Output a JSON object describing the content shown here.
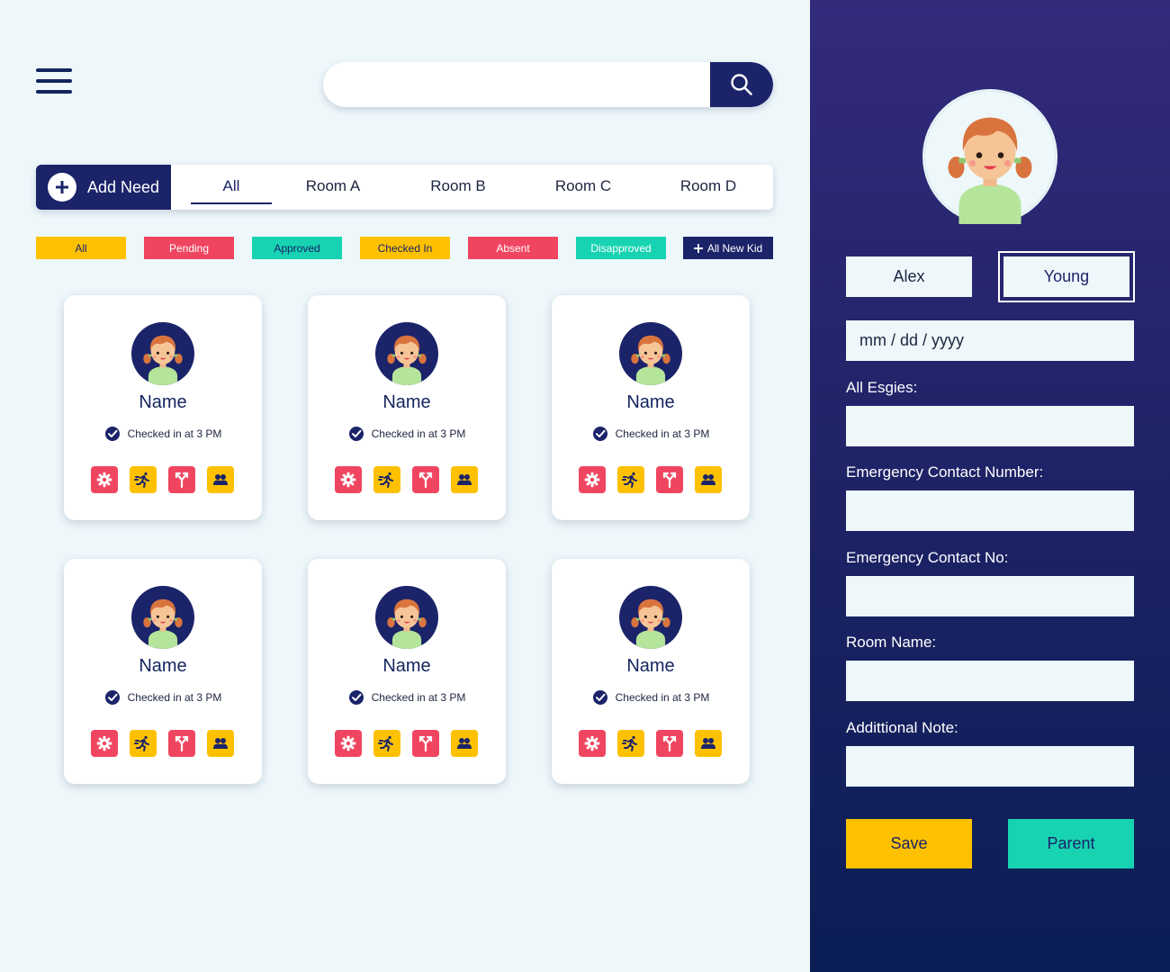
{
  "search": {
    "placeholder": ""
  },
  "tabs": {
    "add_need_label": "Add Need",
    "items": [
      "All",
      "Room A",
      "Room B",
      "Room C",
      "Room D"
    ],
    "active": "All"
  },
  "filters": [
    {
      "label": "All",
      "color": "#fdc100"
    },
    {
      "label": "Pending",
      "color": "#f04560"
    },
    {
      "label": "Approved",
      "color": "#17d3b2"
    },
    {
      "label": "Checked In",
      "color": "#fdc100"
    },
    {
      "label": "Absent",
      "color": "#f04560"
    },
    {
      "label": "Disapproved",
      "color": "#17d3b2"
    },
    {
      "label": "All New Kid",
      "color": "#1b2369"
    }
  ],
  "cards": [
    {
      "name": "Name",
      "status": "Checked in at 3 PM"
    },
    {
      "name": "Name",
      "status": "Checked in at 3 PM"
    },
    {
      "name": "Name",
      "status": "Checked in at 3 PM"
    },
    {
      "name": "Name",
      "status": "Checked in at 3 PM"
    },
    {
      "name": "Name",
      "status": "Checked in at 3 PM"
    },
    {
      "name": "Name",
      "status": "Checked in at 3 PM"
    }
  ],
  "card_icons": [
    "gear-icon",
    "running-icon",
    "fork-icon",
    "group-icon"
  ],
  "panel": {
    "first_name": "Alex",
    "last_name": "Young",
    "date_placeholder": "mm / dd / yyyy",
    "labels": {
      "allergies": "All Esgies:",
      "emergency_number": "Emergency Contact Number:",
      "emergency_no": "Emergency Contact No:",
      "room_name": "Room Name:",
      "note": "Addittional Note:"
    },
    "save_label": "Save",
    "parent_label": "Parent"
  },
  "colors": {
    "navy": "#1b2369",
    "yellow": "#fdc100",
    "pink": "#f04560",
    "teal": "#17d3b2",
    "background": "#eef8fb"
  }
}
